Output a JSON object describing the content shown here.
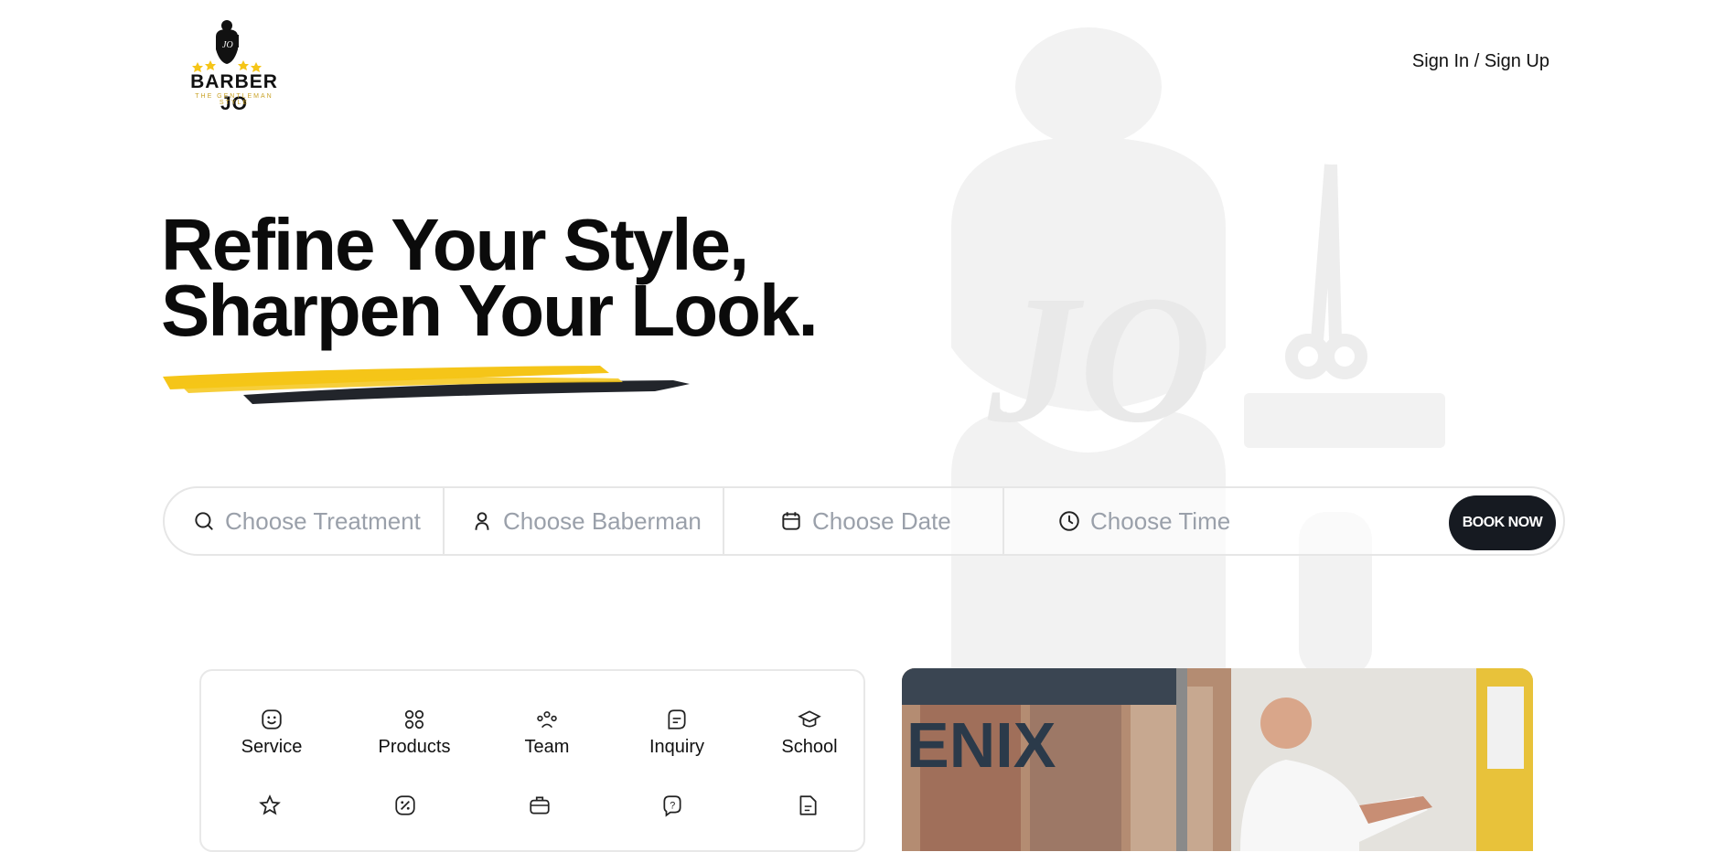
{
  "brand": {
    "name": "BARBER JO",
    "tagline": "THE GENTLEMAN STYLE",
    "monogram": "JO"
  },
  "header": {
    "auth_link": "Sign In / Sign Up"
  },
  "hero": {
    "line1": "Refine Your Style,",
    "line2": "Sharpen Your Look."
  },
  "booking": {
    "treatment": "Choose Treatment",
    "barberman": "Choose Baberman",
    "date": "Choose Date",
    "time": "Choose Time",
    "book_button": "BOOK NOW"
  },
  "quick_menu": {
    "row1": [
      {
        "label": "Service",
        "icon": "face-icon"
      },
      {
        "label": "Products",
        "icon": "grid-icon"
      },
      {
        "label": "Team",
        "icon": "team-icon"
      },
      {
        "label": "Inquiry",
        "icon": "message-icon"
      },
      {
        "label": "School",
        "icon": "graduation-cap-icon"
      }
    ],
    "row2_icons": [
      "star-icon",
      "discount-icon",
      "briefcase-icon",
      "help-icon",
      "document-icon"
    ]
  },
  "photo": {
    "sign_text": "ENIX"
  },
  "colors": {
    "accent": "#F5C518",
    "dark": "#161A21",
    "placeholder": "#9AA0AA"
  }
}
